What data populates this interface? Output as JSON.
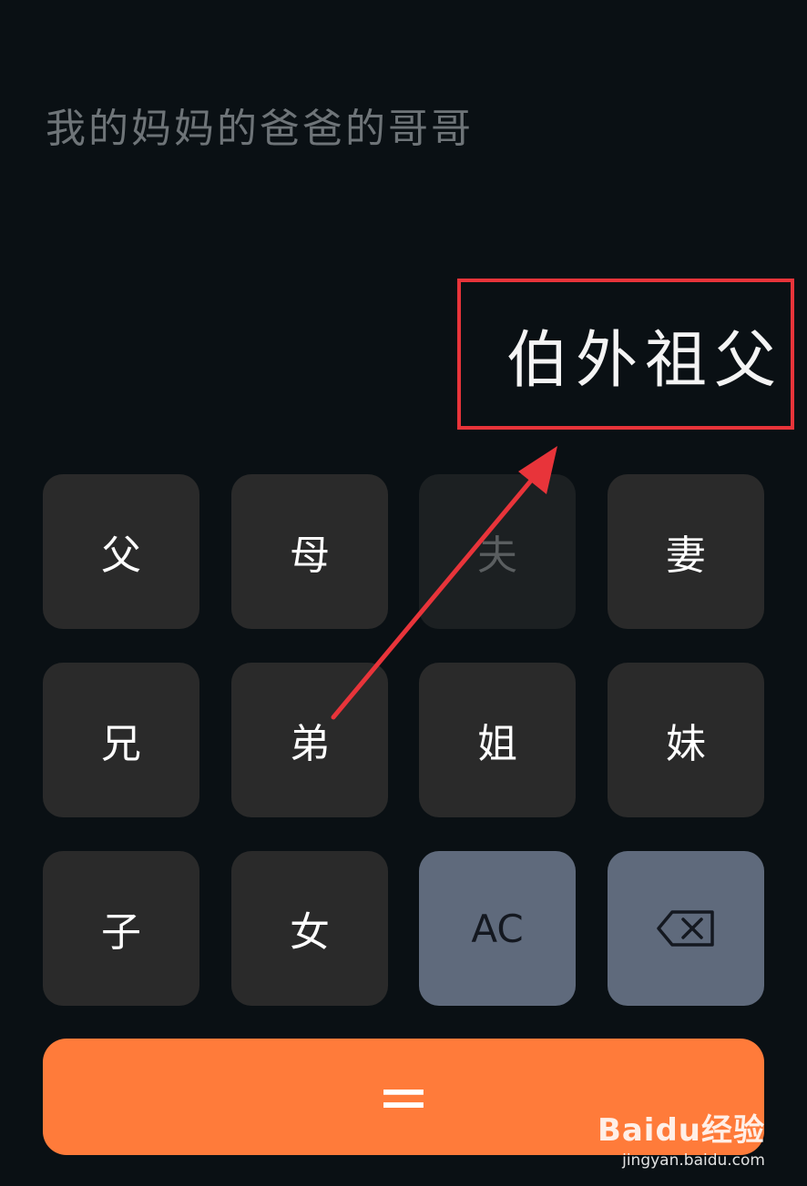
{
  "display": {
    "expression": "我的妈妈的爸爸的哥哥",
    "result": "伯外祖父"
  },
  "keypad": {
    "row1": [
      "父",
      "母",
      "夫",
      "妻"
    ],
    "row2": [
      "兄",
      "弟",
      "姐",
      "妹"
    ],
    "row3": [
      "子",
      "女"
    ],
    "clear_label": "AC",
    "backspace_icon": "backspace-icon",
    "equals_label": "="
  },
  "colors": {
    "background": "#0a1014",
    "key": "#2a2a2a",
    "key_disabled": "#1c2022",
    "function_key": "#5f6a7c",
    "equals": "#ff7b3a",
    "annotation": "#e8343a"
  },
  "watermark": {
    "logo": "Baidu经验",
    "url": "jingyan.baidu.com"
  }
}
